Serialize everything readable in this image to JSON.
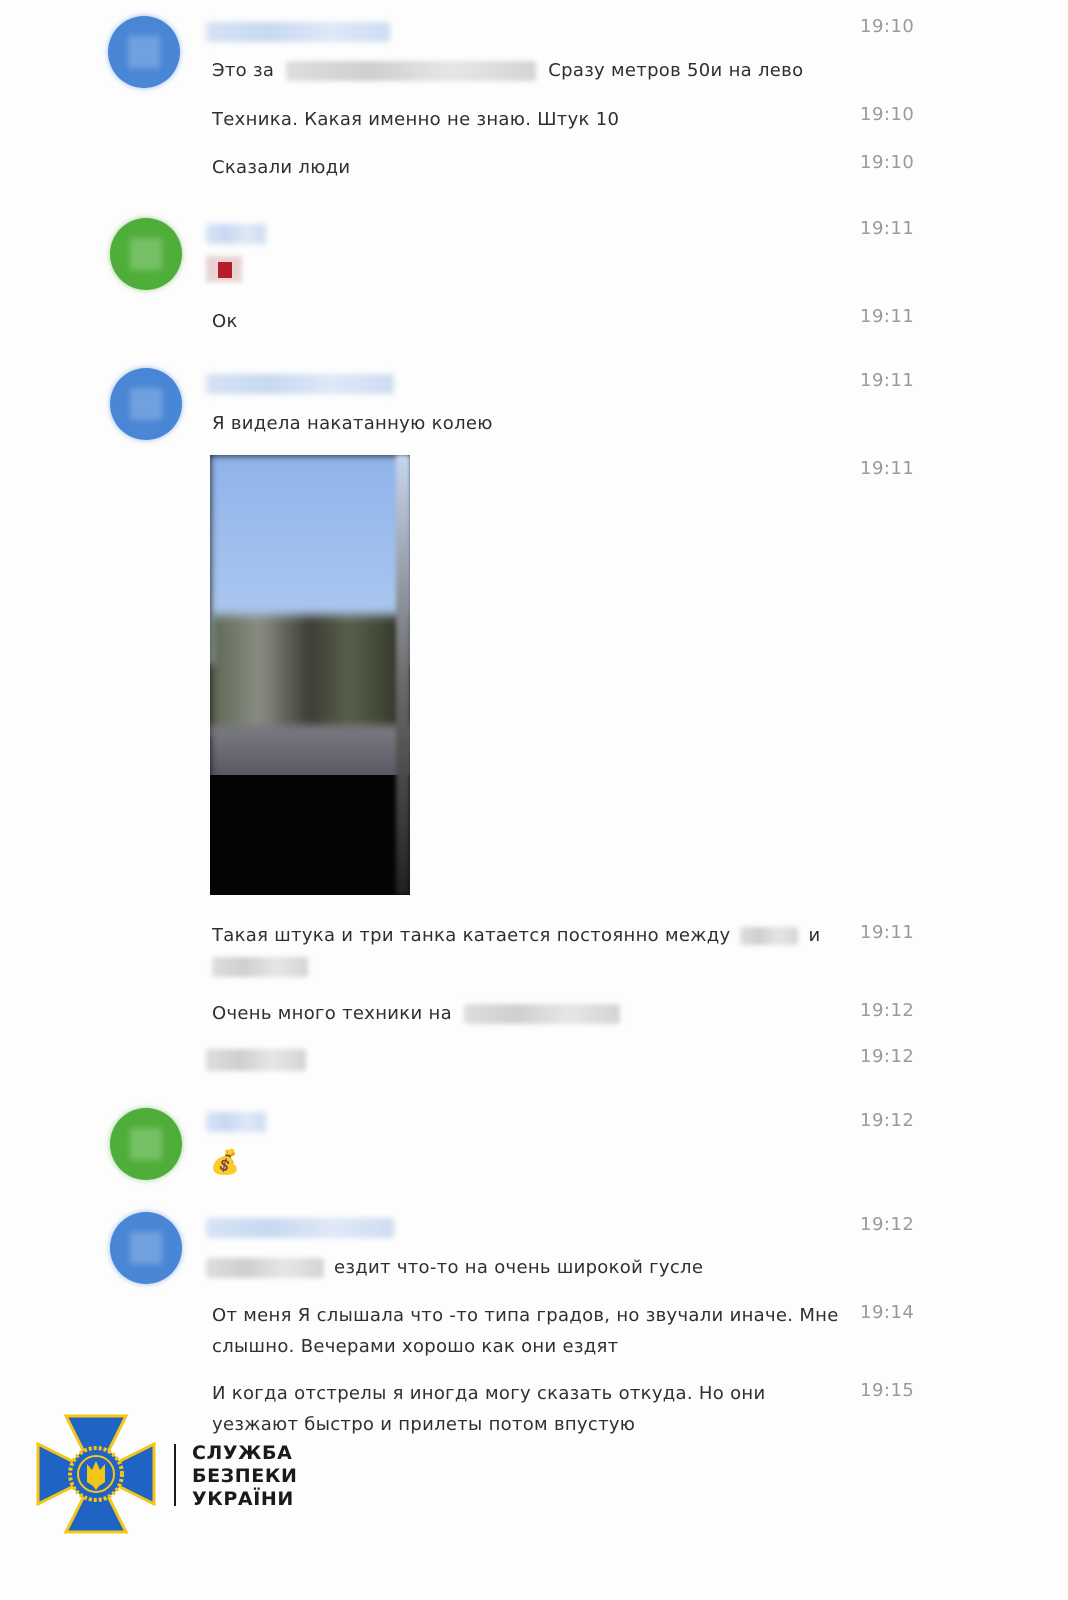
{
  "messages": [
    {
      "time": "19:10",
      "parts": [
        "Это за",
        "Сразу метров 50и на лево"
      ]
    },
    {
      "time": "19:10",
      "text": "Техника. Какая именно не знаю. Штук 10"
    },
    {
      "time": "19:10",
      "text": "Сказали люди"
    },
    {
      "time": "19:11",
      "type": "sticker"
    },
    {
      "time": "19:11",
      "text": "Ок"
    },
    {
      "time": "19:11",
      "text": "Я видела накатанную колею"
    },
    {
      "time": "19:11",
      "type": "photo"
    },
    {
      "time": "19:11",
      "parts": [
        "Такая штука и три танка катается постоянно между",
        "и"
      ]
    },
    {
      "time": "19:12",
      "text": "Очень много техники на"
    },
    {
      "time": "19:12",
      "type": "redacted"
    },
    {
      "time": "19:12",
      "type": "emoji",
      "emoji": "💰"
    },
    {
      "time": "19:12",
      "text": "ездит что-то на очень широкой гусле"
    },
    {
      "time": "19:14",
      "lines": [
        "От меня Я слышала что -то типа градов, но звучали иначе. Мне",
        "слышно. Вечерами хорошо как они ездят"
      ]
    },
    {
      "time": "19:15",
      "lines": [
        "И когда отстрелы я иногда могу сказать откуда. Но они",
        "уезжают быстро и прилеты потом впустую"
      ]
    }
  ],
  "logo": {
    "line1": "СЛУЖБА",
    "line2": "БЕЗПЕКИ",
    "line3": "УКРАЇНИ",
    "colors": {
      "blue": "#1f63c4",
      "yellow": "#f5c518"
    }
  },
  "avatars": {
    "blue": "#4a86d6",
    "green": "#4fae3a"
  }
}
